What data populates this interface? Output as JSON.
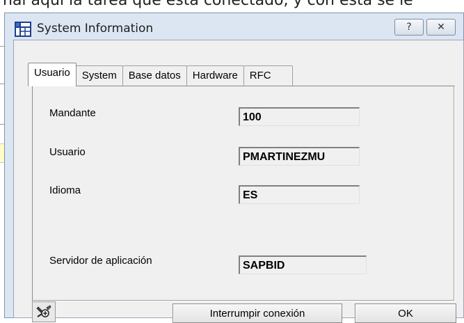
{
  "background": {
    "text": "nal aquí la tarea que está conectado, y con esta se le"
  },
  "window": {
    "title": "System Information",
    "help_button": "?",
    "close_button": "✕",
    "icon": "system-info-grid-icon"
  },
  "tabs": [
    {
      "label": "Usuario",
      "active": true
    },
    {
      "label": "System",
      "active": false
    },
    {
      "label": "Base datos",
      "active": false
    },
    {
      "label": "Hardware",
      "active": false
    },
    {
      "label": "RFC",
      "active": false
    }
  ],
  "fields": {
    "mandante": {
      "label": "Mandante",
      "value": "100"
    },
    "usuario": {
      "label": "Usuario",
      "value": "PMARTINEZMU"
    },
    "idioma": {
      "label": "Idioma",
      "value": "ES"
    },
    "servidor": {
      "label": "Servidor de aplicación",
      "value": "SAPBID"
    }
  },
  "footer": {
    "tools_icon": "tools-wrench-icon",
    "disconnect_label": "Interrumpir conexión",
    "ok_label": "OK"
  },
  "colors": {
    "window_frame": "#dce6f3",
    "client_bg": "#f0f0f0",
    "note_yellow": "#fffcc8"
  }
}
